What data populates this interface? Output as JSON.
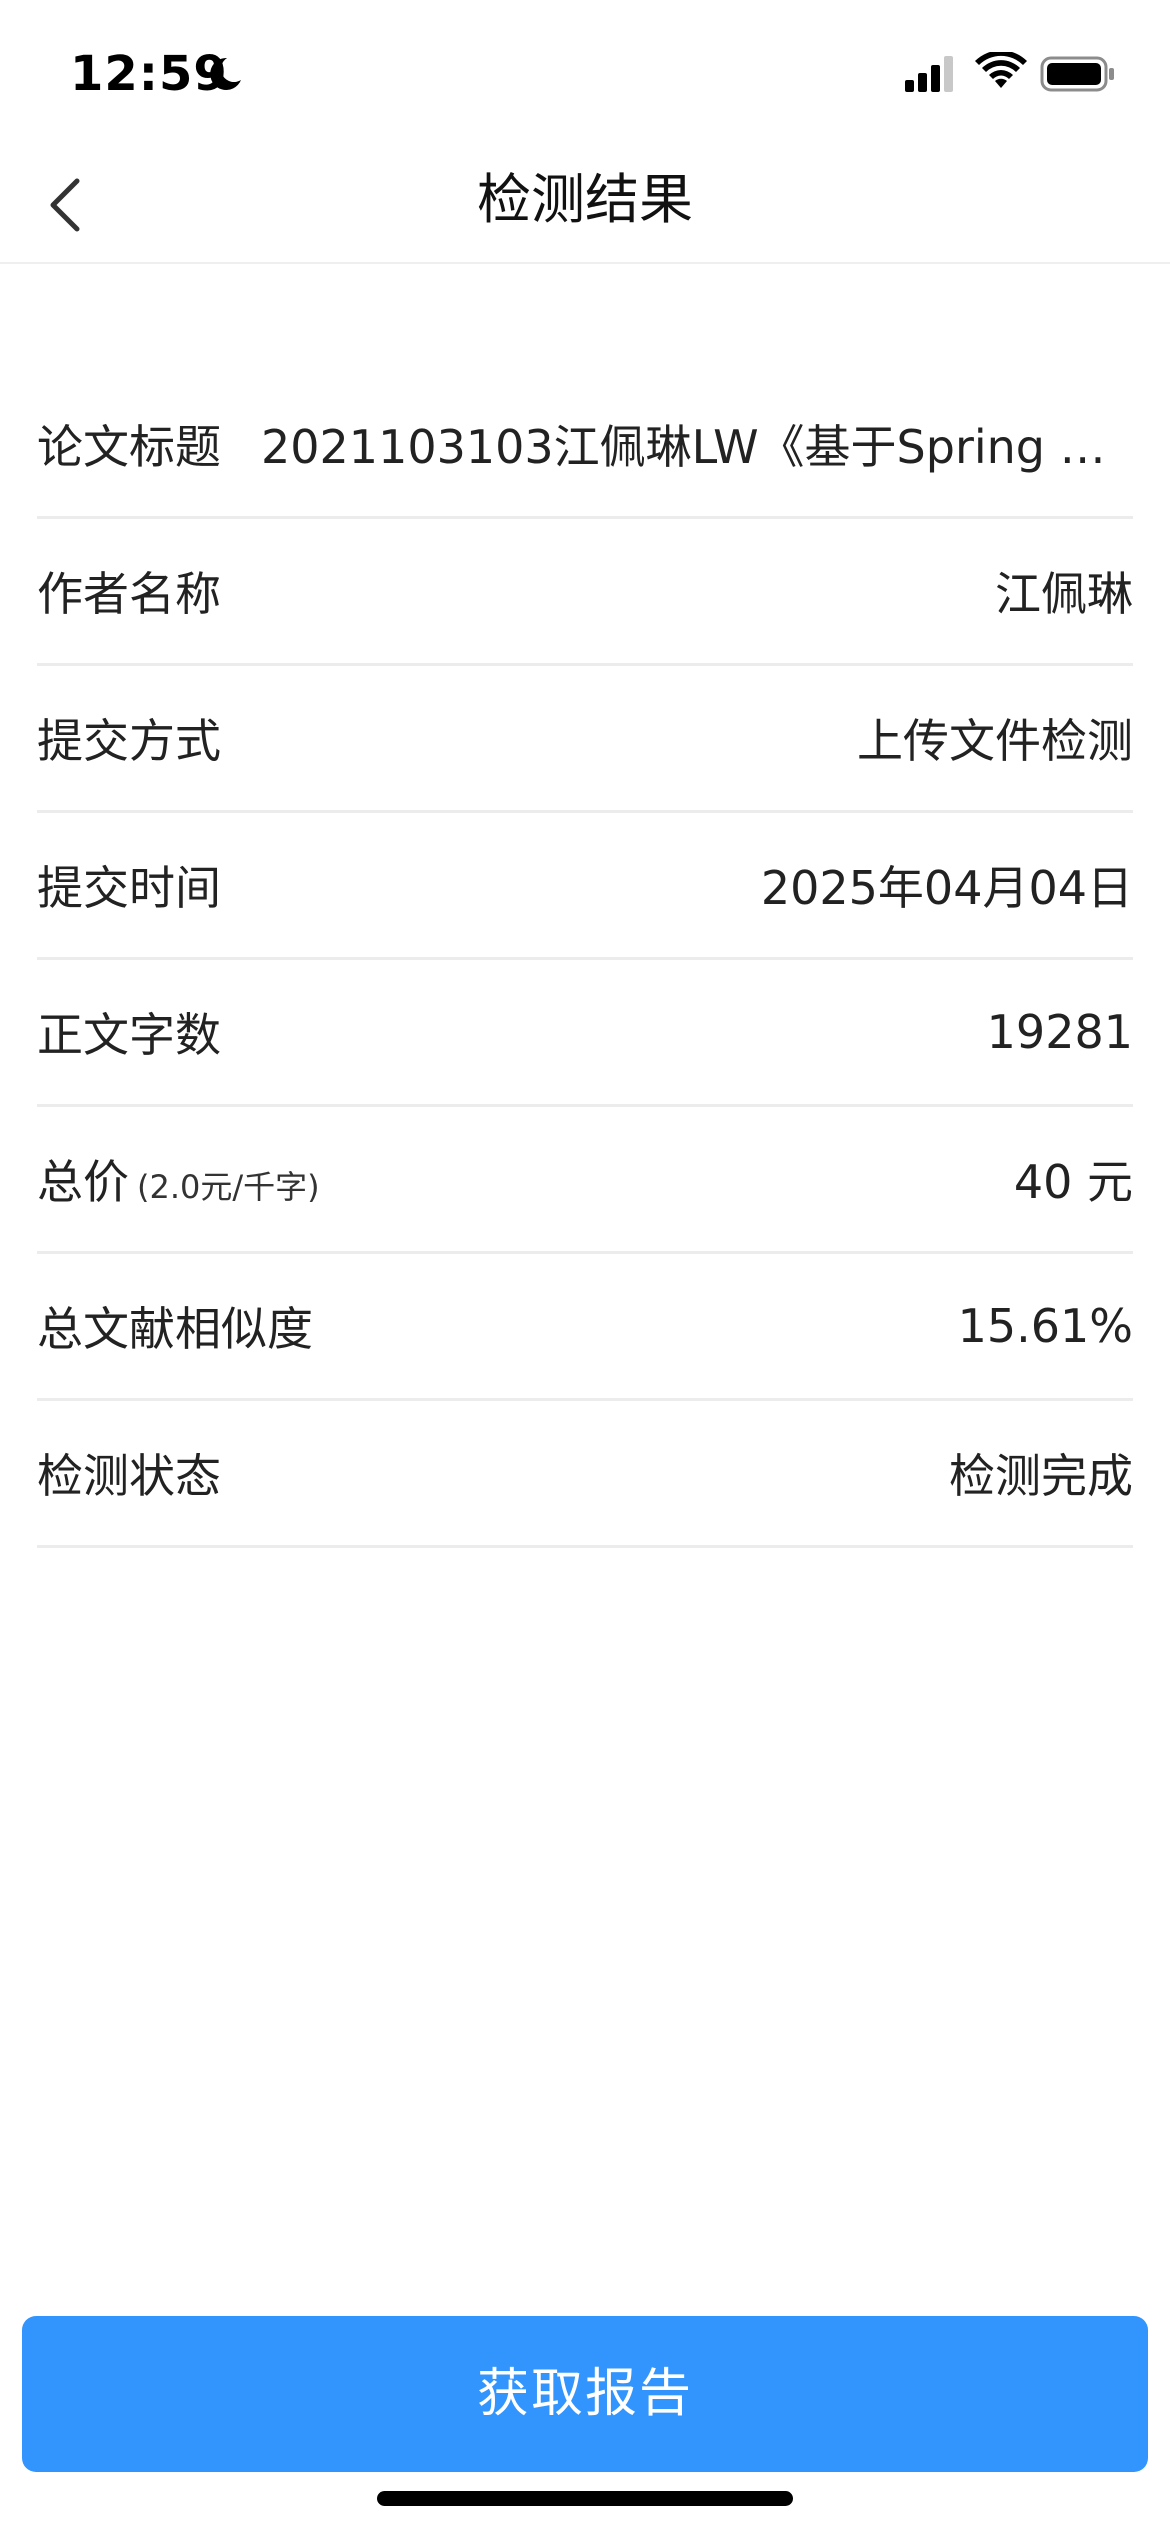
{
  "status_bar": {
    "time": "12:59",
    "icons": [
      "moon-icon",
      "signal-icon",
      "wifi-icon",
      "battery-icon"
    ]
  },
  "nav": {
    "title": "检测结果",
    "back_icon": "chevron-left-icon"
  },
  "details": {
    "title_label": "论文标题",
    "title_value": "2021103103江佩琳LW《基于Spring Boo...",
    "author_label": "作者名称",
    "author_value": "江佩琳",
    "method_label": "提交方式",
    "method_value": "上传文件检测",
    "time_label": "提交时间",
    "time_value": "2025年04月04日",
    "words_label": "正文字数",
    "words_value": "19281",
    "price_label": "总价",
    "price_sub": "(2.0元/千字)",
    "price_value": "40 元",
    "similarity_label": "总文献相似度",
    "similarity_value": "15.61%",
    "status_label": "检测状态",
    "status_value": "检测完成"
  },
  "actions": {
    "report_label": "获取报告"
  },
  "colors": {
    "accent": "#3195fd",
    "divider": "#ececec"
  }
}
